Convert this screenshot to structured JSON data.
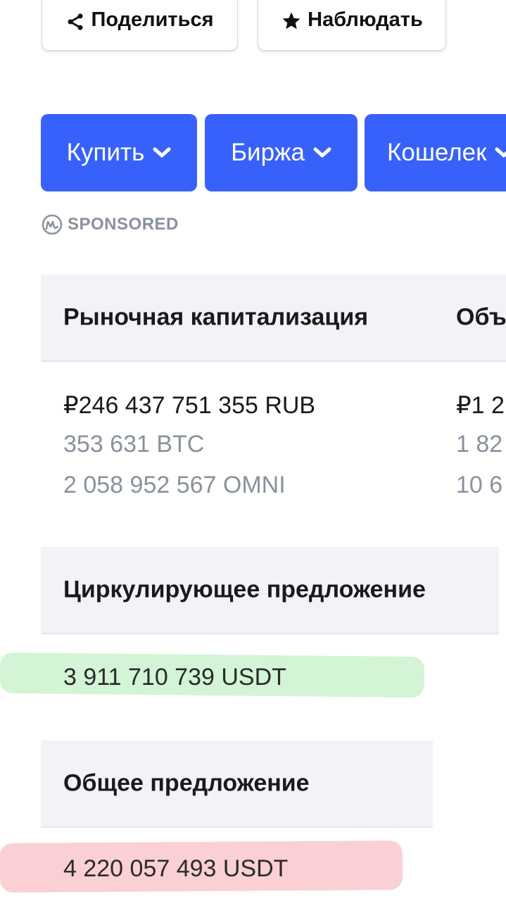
{
  "actions": {
    "share_label": "Поделиться",
    "watch_label": "Наблюдать"
  },
  "menu": {
    "buy_label": "Купить",
    "exchange_label": "Биржа",
    "wallet_label": "Кошелек"
  },
  "sponsored": {
    "label": "SPONSORED"
  },
  "stats": {
    "market_cap": {
      "title": "Рыночная капитализация",
      "value_rub": "₽246 437 751 355 RUB",
      "value_btc": "353 631 BTC",
      "value_omni": "2 058 952 567 OMNI"
    },
    "volume": {
      "title_partial": "Объ",
      "value_rub_partial": "₽1 2",
      "value_btc_partial": "1 82",
      "value_omni_partial": "10 6"
    },
    "circulating_supply": {
      "title": "Циркулирующее предложение",
      "value": "3 911 710 739 USDT"
    },
    "total_supply": {
      "title": "Общее предложение",
      "value": "4 220 057 493 USDT"
    }
  },
  "colors": {
    "accent_blue": "#3861fb",
    "header_bg": "#f2f3f6",
    "muted_text": "#8a919e",
    "highlight_green": "#a0e6a5",
    "highlight_red": "#f596a0"
  },
  "icons": {
    "share": "share-icon",
    "watch": "star-icon",
    "dropdown": "chevron-down-icon",
    "sponsored": "coinmarketcap-logo-icon"
  }
}
